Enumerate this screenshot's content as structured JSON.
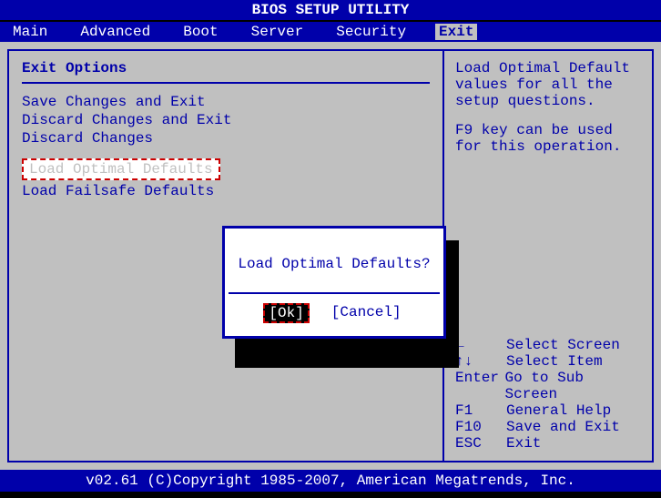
{
  "title": "BIOS SETUP UTILITY",
  "menubar": {
    "items": [
      "Main",
      "Advanced",
      "Boot",
      "Server",
      "Security",
      "Exit"
    ],
    "active": "Exit"
  },
  "left": {
    "section": "Exit Options",
    "items": {
      "save_exit": "Save Changes and Exit",
      "discard_exit": "Discard Changes and Exit",
      "discard": "Discard Changes",
      "load_optimal": "Load Optimal Defaults",
      "load_failsafe": "Load Failsafe Defaults"
    }
  },
  "right": {
    "help1": "Load Optimal Default values for all the setup questions.",
    "help2": "F9 key can be used for this operation.",
    "nav": {
      "r0k": "←",
      "r0v": "Select Screen",
      "r1k": "↑↓",
      "r1v": "Select Item",
      "r2k": "Enter",
      "r2v": "Go to Sub Screen",
      "r3k": "F1",
      "r3v": "General Help",
      "r4k": "F10",
      "r4v": "Save and Exit",
      "r5k": "ESC",
      "r5v": "Exit"
    }
  },
  "dialog": {
    "question": "Load Optimal Defaults?",
    "ok": "[Ok]",
    "cancel": "[Cancel]"
  },
  "footer": "v02.61 (C)Copyright 1985-2007, American Megatrends, Inc."
}
